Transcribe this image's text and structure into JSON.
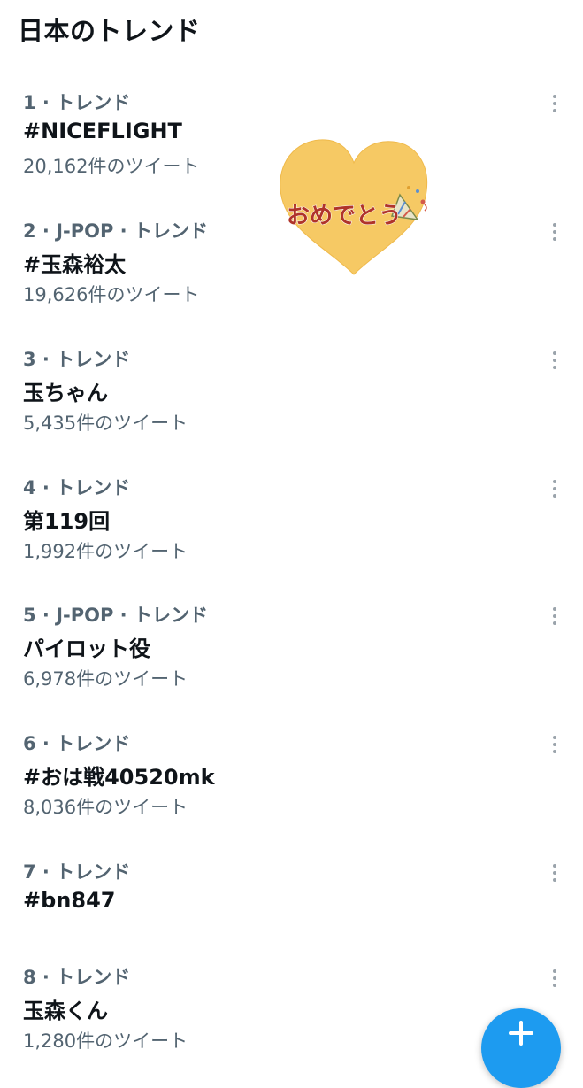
{
  "header": {
    "title": "日本のトレンド"
  },
  "sticker": {
    "text": "おめでとう"
  },
  "trends": [
    {
      "meta": "1 · トレンド",
      "name": "#NICEFLIGHT",
      "count": "20,162件のツイート"
    },
    {
      "meta": "2 · J-POP · トレンド",
      "name": "#玉森裕太",
      "count": "19,626件のツイート"
    },
    {
      "meta": "3 · トレンド",
      "name": "玉ちゃん",
      "count": "5,435件のツイート"
    },
    {
      "meta": "4 · トレンド",
      "name": "第119回",
      "count": "1,992件のツイート"
    },
    {
      "meta": "5 · J-POP · トレンド",
      "name": "パイロット役",
      "count": "6,978件のツイート"
    },
    {
      "meta": "6 · トレンド",
      "name": "#おは戦40520mk",
      "count": "8,036件のツイート"
    },
    {
      "meta": "7 · トレンド",
      "name": "#bn847",
      "count": ""
    },
    {
      "meta": "8 · トレンド",
      "name": "玉森くん",
      "count": "1,280件のツイート"
    }
  ],
  "fab": {
    "icon": "plus-icon"
  },
  "colors": {
    "accent": "#1d9bf0",
    "secondary_text": "#536471",
    "sticker_heart": "#f6c964",
    "sticker_text": "#b0342a"
  }
}
